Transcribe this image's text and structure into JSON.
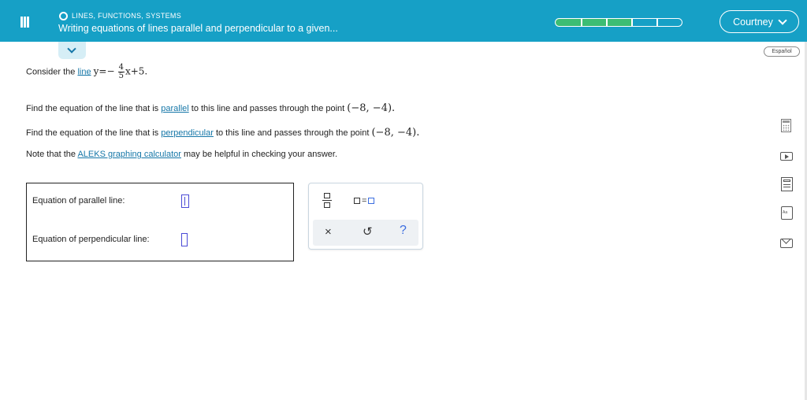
{
  "header": {
    "topic": "LINES, FUNCTIONS, SYSTEMS",
    "title": "Writing equations of lines parallel and perpendicular to a given...",
    "progress": {
      "filled_segments": 3,
      "total_segments": 5
    },
    "user_name": "Courtney"
  },
  "language_button": "Español",
  "question": {
    "consider_prefix": "Consider the",
    "line_link": "line",
    "equation_lhs": "y=",
    "equation_sign": "−",
    "frac_num": "4",
    "frac_den": "5",
    "equation_rest": "x+5.",
    "parallel_prefix": "Find the equation of the line that is",
    "parallel_link": "parallel",
    "parallel_suffix": "to this line and passes through the point",
    "point_parallel": "(−8,  −4).",
    "perp_prefix": "Find the equation of the line that is",
    "perp_link": "perpendicular",
    "perp_suffix": "to this line and passes through the point",
    "point_perp": "(−8,  −4).",
    "note_prefix": "Note that the",
    "note_link": "ALEKS graphing calculator",
    "note_suffix": "may be helpful in checking your answer."
  },
  "answer": {
    "parallel_label": "Equation of parallel line:",
    "perpendicular_label": "Equation of perpendicular line:"
  },
  "toolbar": {
    "equal_sign": "=",
    "clear_symbol": "×",
    "undo_symbol": "↺",
    "help_symbol": "?"
  },
  "side_icons": [
    "calculator-icon",
    "video-icon",
    "textbook-icon",
    "dictionary-icon",
    "mail-icon"
  ],
  "dictionary_icon_text": "Aa",
  "colors": {
    "header": "#16a0c6",
    "progress_fill": "#3cbd74",
    "link": "#1677a8",
    "input_border": "#4a4ad6"
  }
}
